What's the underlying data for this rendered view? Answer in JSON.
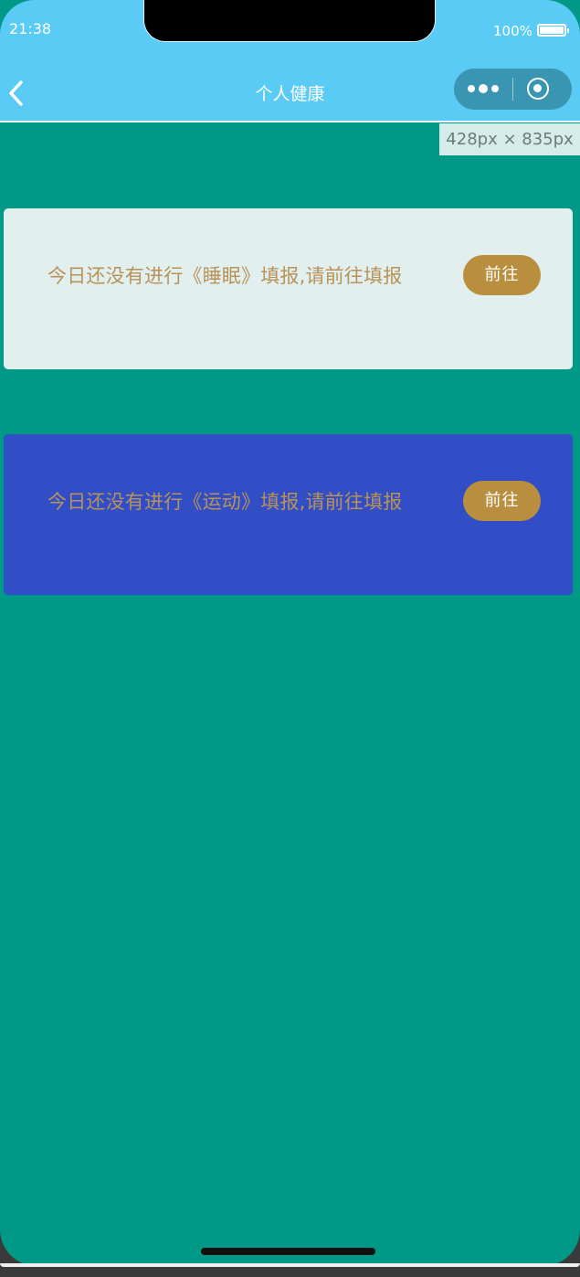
{
  "status_bar": {
    "time": "21:38",
    "battery": "100%"
  },
  "nav": {
    "title": "个人健康",
    "back_icon": "chevron-left-icon",
    "more_icon": "more-dots-icon",
    "close_icon": "target-icon"
  },
  "viewport_tip": "428px × 835px",
  "cards": [
    {
      "message": "今日还没有进行《睡眠》填报,请前往填报",
      "button": "前往"
    },
    {
      "message": "今日还没有进行《运动》填报,请前往填报",
      "button": "前往"
    }
  ],
  "colors": {
    "nav_bg": "#5acbf4",
    "page_bg": "#009886",
    "card_sleep_bg": "#e1f0ef",
    "card_sport_bg": "#314ec7",
    "accent": "#b98f3f"
  }
}
